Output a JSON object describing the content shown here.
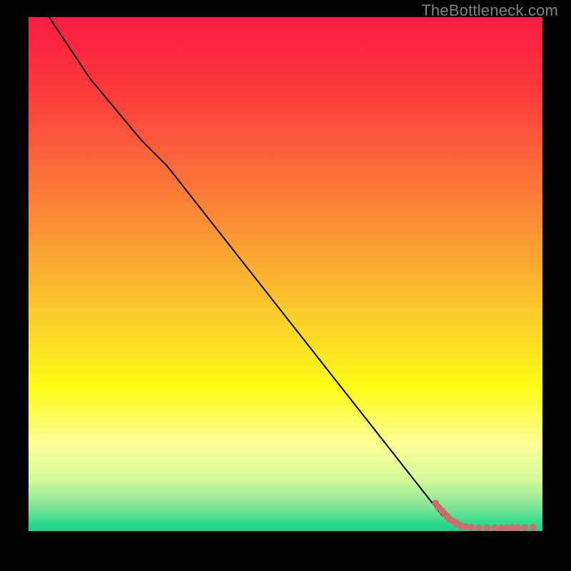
{
  "watermark": "TheBottleneck.com",
  "chart_data": {
    "type": "line",
    "title": "",
    "xlabel": "",
    "ylabel": "",
    "xlim": [
      0,
      100
    ],
    "ylim": [
      0,
      100
    ],
    "gradient_stops": [
      {
        "offset": 0.0,
        "color": "#fa1c41"
      },
      {
        "offset": 0.15,
        "color": "#fb3b3c"
      },
      {
        "offset": 0.3,
        "color": "#fb6c39"
      },
      {
        "offset": 0.45,
        "color": "#fba133"
      },
      {
        "offset": 0.6,
        "color": "#fbd42a"
      },
      {
        "offset": 0.72,
        "color": "#fdfc16"
      },
      {
        "offset": 0.83,
        "color": "#fdff97"
      },
      {
        "offset": 0.9,
        "color": "#d4fa9b"
      },
      {
        "offset": 0.955,
        "color": "#7ee596"
      },
      {
        "offset": 0.985,
        "color": "#2edb8e"
      },
      {
        "offset": 1.0,
        "color": "#1ad58d"
      }
    ],
    "series": [
      {
        "name": "bottleneck-curve",
        "type": "line",
        "color": "#000000",
        "width": 2,
        "x": [
          4,
          12,
          22,
          27,
          80.5
        ],
        "y": [
          100,
          88,
          76,
          71,
          3
        ]
      },
      {
        "name": "data-points",
        "type": "scatter",
        "color": "#ce6d6d",
        "radius": 5,
        "x": [
          79.2,
          79.8,
          80.5,
          81.0,
          81.5,
          82.0,
          82.6,
          83.2,
          84.0,
          85.0,
          86.2,
          87.6,
          89.2,
          90.8,
          92.0,
          93.2,
          94.2,
          95.2,
          96.6,
          98.2
        ],
        "y": [
          5.4,
          4.6,
          3.9,
          3.3,
          2.8,
          2.3,
          1.9,
          1.5,
          1.1,
          0.85,
          0.7,
          0.6,
          0.55,
          0.55,
          0.55,
          0.58,
          0.6,
          0.63,
          0.66,
          0.7
        ]
      }
    ]
  }
}
